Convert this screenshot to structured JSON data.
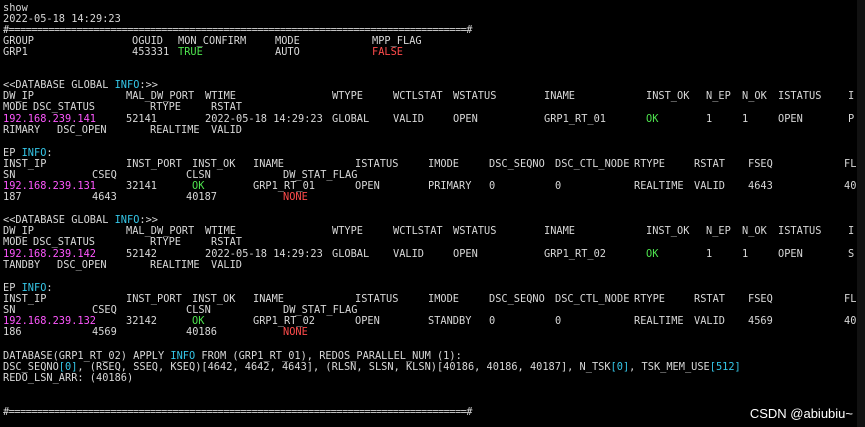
{
  "colors": {
    "background": "#000000",
    "text": "#d8d8d8",
    "ip_magenta": "#ff57ff",
    "ok_green": "#4ee44e",
    "false_red": "#ff4b4b",
    "keyword_cyan": "#35c7e8"
  },
  "terminal": {
    "command": "show",
    "timestamp": "2022-05-18 14:29:23",
    "separator": "#=================================================================================#",
    "bottom_separator": "#=================================================================================#"
  },
  "group": {
    "headers": [
      "GROUP",
      "OGUID",
      "MON_CONFIRM",
      "MODE",
      "MPP_FLAG"
    ],
    "values": [
      "GRP1",
      "453331",
      "TRUE",
      "AUTO",
      "FALSE"
    ]
  },
  "db_global_1": {
    "title_pre": "<<DATABASE GLOBAL ",
    "title_info": "INFO",
    "title_post": ":>>",
    "headers1": [
      "DW_IP",
      "MAL_DW_PORT",
      "WTIME",
      "WTYPE",
      "WCTLSTAT",
      "WSTATUS",
      "INAME",
      "INST_OK",
      "N_EP",
      "N_OK",
      "ISTATUS",
      "I"
    ],
    "headers2": [
      "MODE",
      "DSC_STATUS",
      "RTYPE",
      "RSTAT"
    ],
    "values1": [
      "192.168.239.141",
      "52141",
      "2022-05-18 14:29:23",
      "GLOBAL",
      "VALID",
      "OPEN",
      "GRP1_RT_01",
      "OK",
      "1",
      "1",
      "OPEN",
      "P"
    ],
    "values2": [
      "RIMARY",
      "DSC_OPEN",
      "REALTIME",
      "VALID"
    ]
  },
  "ep_1": {
    "title_pre": "EP ",
    "title_info": "INFO",
    "title_post": ":",
    "headers1": [
      "INST_IP",
      "INST_PORT",
      "INST_OK",
      "INAME",
      "ISTATUS",
      "IMODE",
      "DSC_SEQNO",
      "DSC_CTL_NODE",
      "RTYPE",
      "RSTAT",
      "FSEQ",
      "FL"
    ],
    "headers2": [
      "SN",
      "CSEQ",
      "CLSN",
      "DW_STAT_FLAG"
    ],
    "values1": [
      "192.168.239.131",
      "32141",
      "OK",
      "GRP1_RT_01",
      "OPEN",
      "PRIMARY",
      "0",
      "0",
      "REALTIME",
      "VALID",
      "4643",
      "40"
    ],
    "values2": [
      "187",
      "4643",
      "40187",
      "NONE"
    ]
  },
  "db_global_2": {
    "title_pre": "<<DATABASE GLOBAL ",
    "title_info": "INFO",
    "title_post": ":>>",
    "headers1": [
      "DW_IP",
      "MAL_DW_PORT",
      "WTIME",
      "WTYPE",
      "WCTLSTAT",
      "WSTATUS",
      "INAME",
      "INST_OK",
      "N_EP",
      "N_OK",
      "ISTATUS",
      "I"
    ],
    "headers2": [
      "MODE",
      "DSC_STATUS",
      "RTYPE",
      "RSTAT"
    ],
    "values1": [
      "192.168.239.142",
      "52142",
      "2022-05-18 14:29:23",
      "GLOBAL",
      "VALID",
      "OPEN",
      "GRP1_RT_02",
      "OK",
      "1",
      "1",
      "OPEN",
      "S"
    ],
    "values2": [
      "TANDBY",
      "DSC_OPEN",
      "REALTIME",
      "VALID"
    ]
  },
  "ep_2": {
    "title_pre": "EP ",
    "title_info": "INFO",
    "title_post": ":",
    "headers1": [
      "INST_IP",
      "INST_PORT",
      "INST_OK",
      "INAME",
      "ISTATUS",
      "IMODE",
      "DSC_SEQNO",
      "DSC_CTL_NODE",
      "RTYPE",
      "RSTAT",
      "FSEQ",
      "FL"
    ],
    "headers2": [
      "SN",
      "CSEQ",
      "CLSN",
      "DW_STAT_FLAG"
    ],
    "values1": [
      "192.168.239.132",
      "32142",
      "OK",
      "GRP1_RT_02",
      "OPEN",
      "STANDBY",
      "0",
      "0",
      "REALTIME",
      "VALID",
      "4569",
      "40"
    ],
    "values2": [
      "186",
      "4569",
      "40186",
      "NONE"
    ]
  },
  "apply": {
    "line1_pre": "DATABASE(GRP1_RT_02) APPLY ",
    "line1_info": "INFO",
    "line1_post": " FROM (GRP1_RT_01), REDOS_PARALLEL_NUM (1):",
    "line2_a": "DSC_SEQNO",
    "line2_b": "[0]",
    "line2_c": ", (RSEQ, SSEQ, KSEQ)[4642, 4642, 4643], (RLSN, SLSN, KLSN)[40186, 40186, 40187], N_TSK",
    "line2_d": "[0]",
    "line2_e": ", TSK_MEM_USE",
    "line2_f": "[512]",
    "line3": "REDO_LSN_ARR: (40186)"
  },
  "watermark": "CSDN @abiubiu~"
}
